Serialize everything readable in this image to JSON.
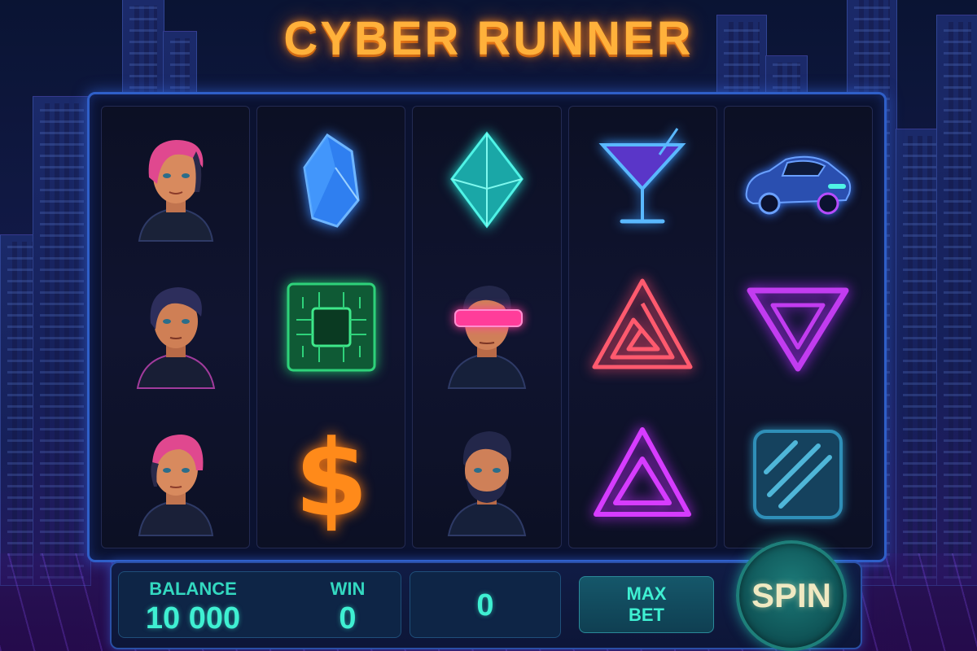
{
  "game": {
    "title": "CYBER RUNNER"
  },
  "reels": [
    {
      "symbols": [
        "woman-pink-hair",
        "woman-dark-hair",
        "woman-pink-hair-2"
      ]
    },
    {
      "symbols": [
        "blue-crystal",
        "green-chip",
        "orange-dollar"
      ]
    },
    {
      "symbols": [
        "teal-diamond",
        "man-visor",
        "man-beard"
      ]
    },
    {
      "symbols": [
        "cocktail-glass",
        "orange-spiral-triangle",
        "magenta-triangle"
      ]
    },
    {
      "symbols": [
        "blue-sports-car",
        "purple-down-triangle",
        "teal-striped-square"
      ]
    }
  ],
  "hud": {
    "balance_label": "BALANCE",
    "balance_value": "10 000",
    "win_label": "WIN",
    "win_value": "0",
    "bet_value": "0",
    "maxbet_line1": "MAX",
    "maxbet_line2": "BET",
    "spin_label": "SPIN"
  },
  "colors": {
    "title": "#ffb13b",
    "accent": "#3ff0d2",
    "frame": "#2f5fc8",
    "background": "#131a4a"
  }
}
